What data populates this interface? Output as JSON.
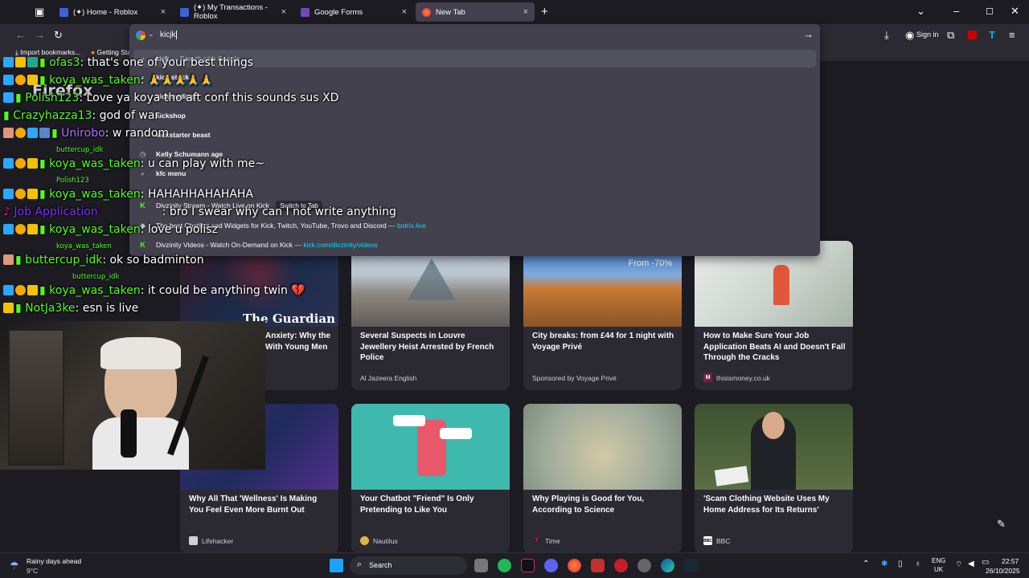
{
  "tabs": [
    {
      "label": "(✦) Home - Roblox",
      "close": "×"
    },
    {
      "label": "(✦) My Transactions - Roblox",
      "close": "×"
    },
    {
      "label": "Google Forms",
      "close": "×"
    },
    {
      "label": "New Tab",
      "close": "×"
    }
  ],
  "new_tab_glyph": "+",
  "toolbar": {
    "sign_in": "Sign in"
  },
  "bookmarks": {
    "import": "Import bookmarks...",
    "getting_started": "Getting Sta"
  },
  "urlbar": {
    "value": "kicjk",
    "suggestions": [
      {
        "text": "kicjk",
        "suffix": " — Search with Google"
      },
      {
        "text": "kick stock"
      },
      {
        "text": "kick trading"
      },
      {
        "text": "kickshop"
      },
      {
        "text": "kickstarter beast"
      },
      {
        "text": "Kelly Schumann age"
      },
      {
        "text": "kfc menu"
      },
      {
        "text": "Divzinity Stream - Watch Live on Kick",
        "action": "Switch to Tab"
      },
      {
        "text": "The best ChatBot and Widgets for Kick, Twitch, YouTube, Trovo and Discord",
        "url": "botrix.live"
      },
      {
        "text": "Divzinity Videos - Watch On-Demand on Kick",
        "url": "kick.com/divzinity/videos"
      }
    ]
  },
  "cards": [
    {
      "title": "Anxiety: Why the ...With Young Men",
      "line1": "Anxiety: Why the",
      "line2": "With Young Men",
      "source": ""
    },
    {
      "title": "Several Suspects in Louvre Jewellery Heist Arrested by French Police",
      "source": "Al Jazeera English"
    },
    {
      "title": "City breaks: from £44 for 1 night with Voyage Privé",
      "source": "Sponsored by Voyage Privé",
      "overlay": "From -70%"
    },
    {
      "title": "How to Make Sure Your Job Application Beats AI and Doesn't Fall Through the Cracks",
      "source": "thisismoney.co.uk",
      "logo": "M"
    },
    {
      "title": "Why All That 'Wellness' Is Making You Feel Even More Burnt Out",
      "source": "Lifehacker"
    },
    {
      "title": "Your Chatbot \"Friend\" Is Only Pretending to Like You",
      "source": "Nautilus"
    },
    {
      "title": "Why Playing is Good for You, According to Science",
      "source": "Time",
      "logo": "T"
    },
    {
      "title": "'Scam Clothing Website Uses My Home Address for Its Returns'",
      "source": "BBC",
      "logo": "BBC"
    }
  ],
  "guardian_logo": "The Guardian",
  "chat": [
    {
      "user": "ofas3",
      "msg": ": that's one of your best things",
      "color": "#53fc18"
    },
    {
      "user": "koya_was_taken",
      "msg": ":",
      "color": "#53fc18",
      "emotes": "🙏🙏🙏🙏🙏"
    },
    {
      "user": "Polish123",
      "msg": ": Love ya koya tho aft conf this sounds sus XD",
      "color": "#53fc18"
    },
    {
      "user": "Crazyhazza13",
      "msg": ": god of war",
      "color": "#53fc18"
    },
    {
      "user": "Unirobo",
      "msg": ": w random",
      "color": "#a970ff"
    },
    {
      "user": "koya_was_taken",
      "msg": ": u can play with me~",
      "color": "#53fc18"
    },
    {
      "user": "koya_was_taken",
      "msg": ": HAHAHHAHAHAHA",
      "color": "#53fc18"
    },
    {
      "user": "Job Application",
      "msg": ": bro I swear why can I not write anything",
      "color": "#7b2ff7"
    },
    {
      "user": "koya_was_taken",
      "msg": ": love u polisz",
      "color": "#53fc18"
    },
    {
      "user": "buttercup_idk",
      "msg": ": ok so badminton",
      "color": "#53fc18"
    },
    {
      "user": "koya_was_taken",
      "msg": ": it could be anything twin 💔",
      "color": "#53fc18"
    },
    {
      "user": "NotJa3ke",
      "msg": ": esn is live",
      "color": "#53fc18"
    }
  ],
  "replies": [
    "buttercup_idk",
    "Polish123",
    "koya_was_taken",
    "buttercup_idk"
  ],
  "firefox_watermark": "Firefox",
  "taskbar": {
    "weather_title": "Rainy days ahead",
    "weather_temp": "9°C",
    "search": "Search",
    "lang1": "ENG",
    "lang2": "UK",
    "time": "22:57",
    "date": "26/10/2025"
  }
}
